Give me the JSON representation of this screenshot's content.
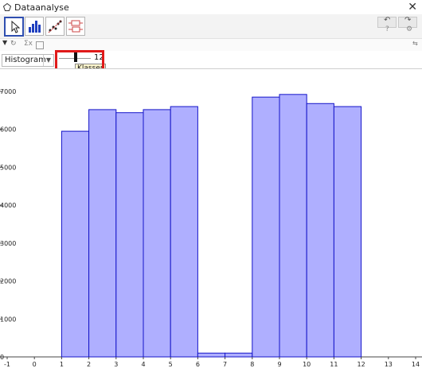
{
  "window": {
    "title": "Dataanalyse",
    "close_symbol": "✕"
  },
  "toolbar": {
    "tools": [
      "pointer-tool",
      "histogram-tool",
      "scatter-tool",
      "boxplot-tool"
    ],
    "undo_symbol": "↶",
    "redo_symbol": "↷"
  },
  "controls": {
    "chart_type": "Histogram",
    "classes_value": "12",
    "classes_tooltip": "Klasser"
  },
  "chart_data": {
    "type": "bar",
    "bins": [
      {
        "start": 1,
        "end": 2,
        "value": 5950
      },
      {
        "start": 2,
        "end": 3,
        "value": 6520
      },
      {
        "start": 3,
        "end": 4,
        "value": 6440
      },
      {
        "start": 4,
        "end": 5,
        "value": 6520
      },
      {
        "start": 5,
        "end": 6,
        "value": 6600
      },
      {
        "start": 6,
        "end": 7,
        "value": 100
      },
      {
        "start": 7,
        "end": 8,
        "value": 100
      },
      {
        "start": 8,
        "end": 9,
        "value": 6850
      },
      {
        "start": 9,
        "end": 10,
        "value": 6920
      },
      {
        "start": 10,
        "end": 11,
        "value": 6680
      },
      {
        "start": 11,
        "end": 12,
        "value": 6600
      },
      {
        "start": 12,
        "end": 13,
        "value": 0
      }
    ],
    "xlim": [
      -1,
      14
    ],
    "ylim": [
      0,
      7000
    ],
    "x_ticks": [
      "-1",
      "0",
      "1",
      "2",
      "3",
      "4",
      "5",
      "6",
      "7",
      "8",
      "9",
      "10",
      "11",
      "12",
      "13",
      "14"
    ],
    "y_ticks": [
      "0",
      "1000",
      "2000",
      "3000",
      "4000",
      "5000",
      "6000",
      "7000"
    ],
    "colors": {
      "fill": "#afafff",
      "stroke": "#1515c8"
    }
  }
}
